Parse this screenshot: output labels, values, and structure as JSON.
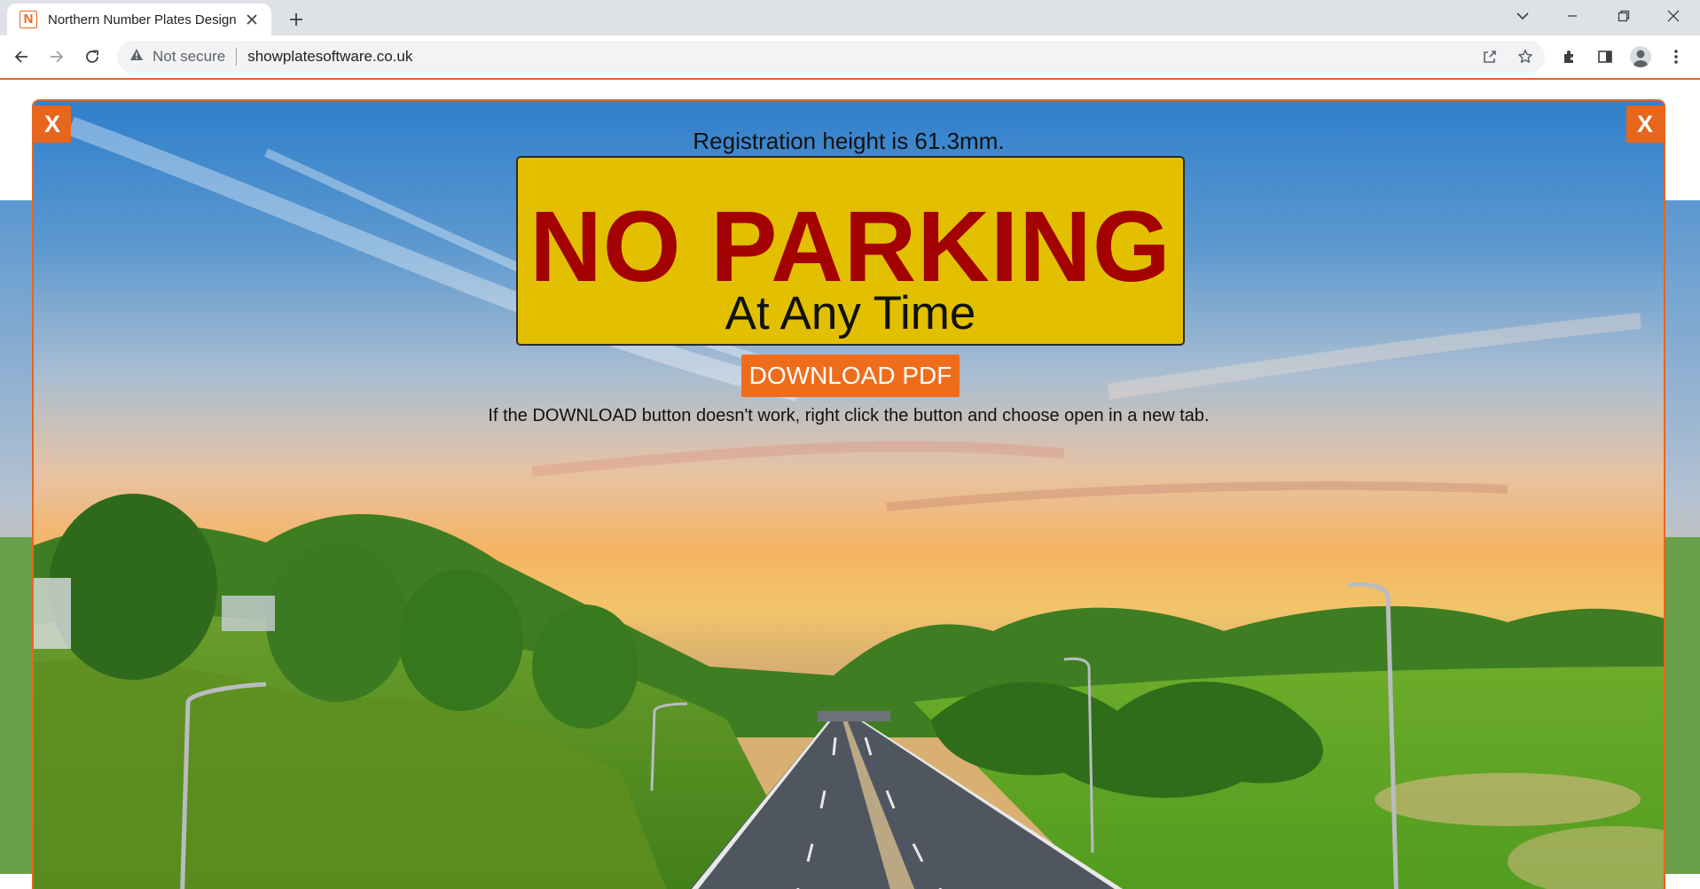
{
  "browser": {
    "tab": {
      "title": "Northern Number Plates Design",
      "favicon_letter": "N"
    },
    "address": {
      "security": "Not secure",
      "url": "showplatesoftware.co.uk"
    }
  },
  "modal": {
    "close_left": "X",
    "close_right": "X",
    "height_text": "Registration height is 61.3mm.",
    "plate": {
      "line1": "NO PARKING",
      "line2": "At Any Time"
    },
    "download_label": "DOWNLOAD PDF",
    "hint": "If the DOWNLOAD button doesn't work, right click the button and choose open in a new tab."
  },
  "colors": {
    "accent": "#e8651c",
    "plate_background": "#e2c000",
    "plate_main_text": "#a30000"
  }
}
